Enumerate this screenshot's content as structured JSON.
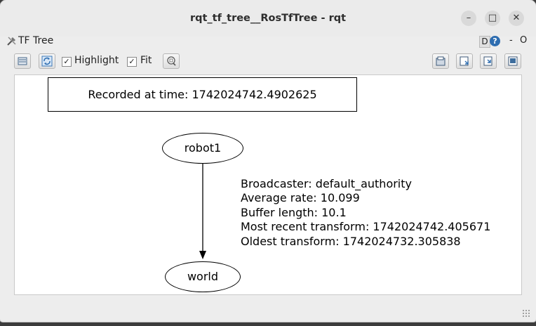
{
  "window": {
    "title": "rqt_tf_tree__RosTfTree - rqt",
    "controls": {
      "minimize": "–",
      "maximize": "□",
      "close": "✕"
    }
  },
  "plugin_bar": {
    "title": "TF Tree",
    "d_label": "D",
    "help_label": "?",
    "dash_label": "-",
    "o_label": "O"
  },
  "toolbar": {
    "highlight_label": "Highlight",
    "highlight_checked": "✓",
    "fit_label": "Fit",
    "fit_checked": "✓"
  },
  "graph": {
    "recorded_text": "Recorded at time: 1742024742.4902625",
    "nodes": {
      "parent": "robot1",
      "child": "world"
    },
    "edge_info": {
      "broadcaster": "Broadcaster: default_authority",
      "average_rate": "Average rate: 10.099",
      "buffer_length": "Buffer length: 10.1",
      "most_recent": "Most recent transform: 1742024742.405671",
      "oldest": "Oldest transform: 1742024732.305838"
    }
  },
  "colors": {
    "window_bg": "#ededed",
    "canvas_bg": "#ffffff",
    "accent_blue": "#2e6db0"
  }
}
